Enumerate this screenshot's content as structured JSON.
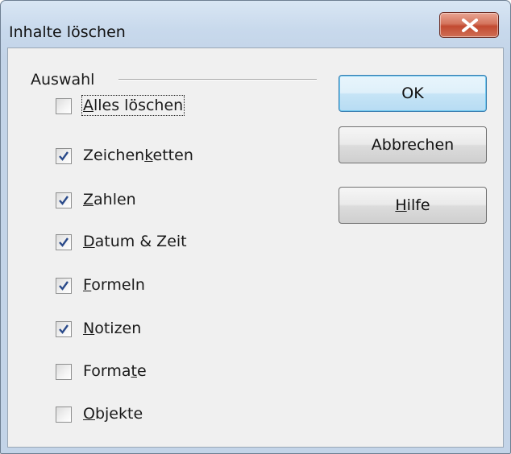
{
  "window": {
    "title": "Inhalte löschen"
  },
  "group": {
    "label": "Auswahl"
  },
  "checkboxes": [
    {
      "pre": "",
      "mn": "A",
      "post": "lles löschen",
      "checked": false
    },
    {
      "pre": "Zeichen",
      "mn": "k",
      "post": "etten",
      "checked": true
    },
    {
      "pre": "",
      "mn": "Z",
      "post": "ahlen",
      "checked": true
    },
    {
      "pre": "",
      "mn": "D",
      "post": "atum & Zeit",
      "checked": true
    },
    {
      "pre": "",
      "mn": "F",
      "post": "ormeln",
      "checked": true
    },
    {
      "pre": "",
      "mn": "N",
      "post": "otizen",
      "checked": true
    },
    {
      "pre": "Forma",
      "mn": "t",
      "post": "e",
      "checked": false
    },
    {
      "pre": "",
      "mn": "O",
      "post": "bjekte",
      "checked": false
    }
  ],
  "buttons": {
    "ok": "OK",
    "cancel": "Abbrechen",
    "help_mn": "H",
    "help_rest": "ilfe"
  },
  "colors": {
    "close_button": "#c24a31",
    "default_button_border": "#3c7fb1"
  }
}
